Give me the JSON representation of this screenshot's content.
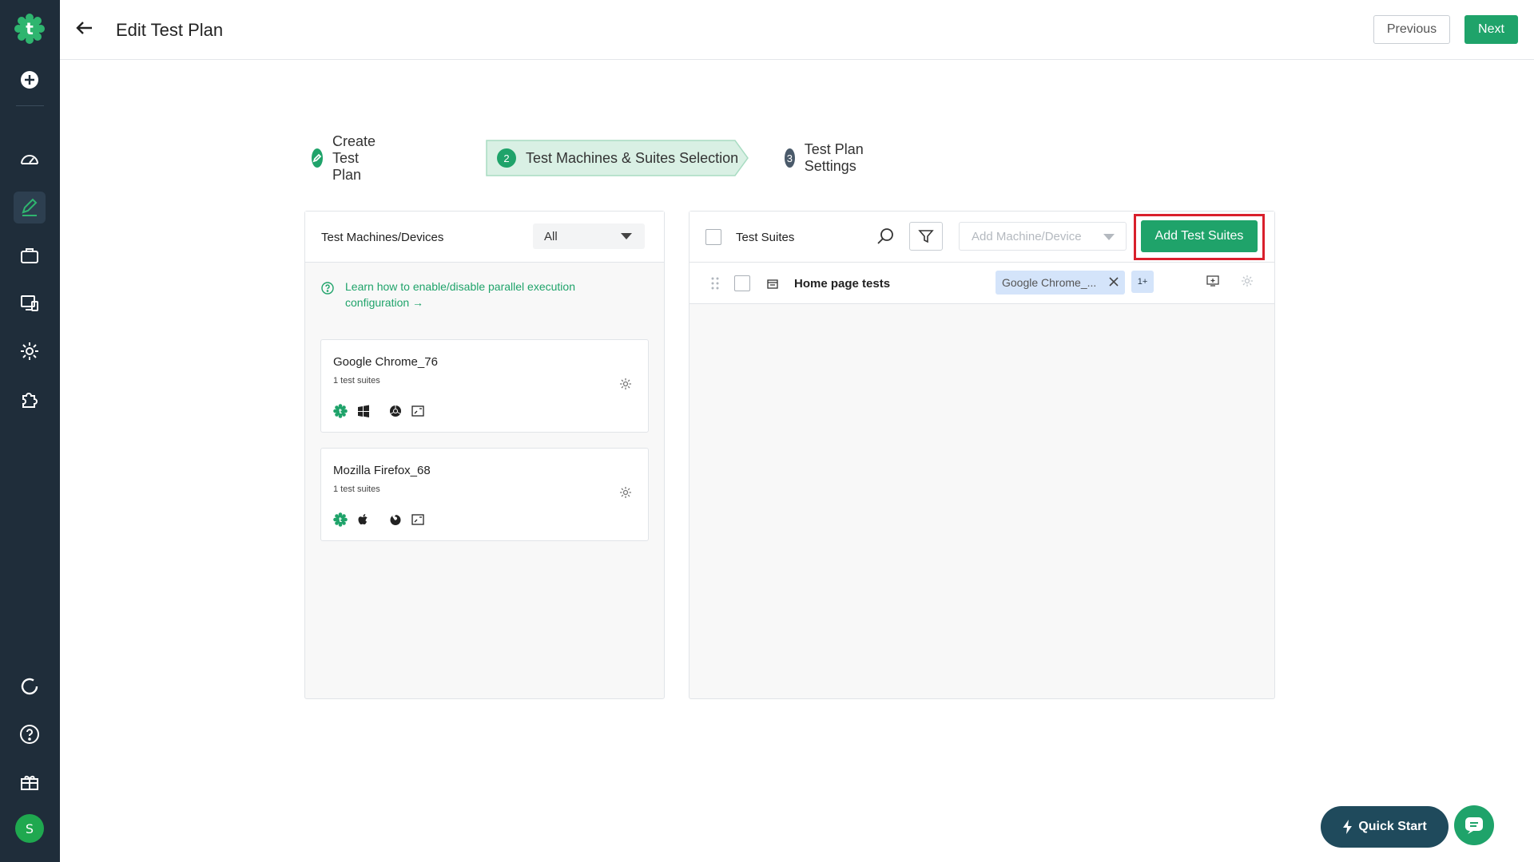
{
  "sidebar": {
    "logo_icon": "testsigma-logo-icon",
    "items": [
      {
        "name": "add-icon"
      },
      {
        "name": "dashboard-icon"
      },
      {
        "name": "test-plan-icon",
        "active": true
      },
      {
        "name": "briefcase-icon"
      },
      {
        "name": "test-devices-icon"
      },
      {
        "name": "settings-icon"
      },
      {
        "name": "addons-icon"
      }
    ],
    "bottom_items": [
      {
        "name": "refresh-icon"
      },
      {
        "name": "help-icon"
      },
      {
        "name": "gift-icon"
      }
    ],
    "avatar_initial": "S"
  },
  "header": {
    "title": "Edit Test Plan",
    "previous_label": "Previous",
    "next_label": "Next"
  },
  "stepper": {
    "steps": [
      {
        "number": "",
        "label": "Create Test Plan",
        "state": "done"
      },
      {
        "number": "2",
        "label": "Test Machines & Suites Selection",
        "state": "active"
      },
      {
        "number": "3",
        "label": "Test Plan Settings",
        "state": "pending"
      }
    ]
  },
  "machines_panel": {
    "title": "Test Machines/Devices",
    "filter_value": "All",
    "help_text": "Learn how to enable/disable parallel execution configuration →",
    "machines": [
      {
        "name": "Google Chrome_76",
        "suites": "1 test suites",
        "os_icon": "windows-icon",
        "browser_icon": "chrome-icon"
      },
      {
        "name": "Mozilla Firefox_68",
        "suites": "1 test suites",
        "os_icon": "apple-icon",
        "browser_icon": "firefox-icon"
      }
    ]
  },
  "suites_panel": {
    "title": "Test Suites",
    "add_machine_placeholder": "Add Machine/Device",
    "add_suites_label": "Add Test Suites",
    "rows": [
      {
        "name": "Home page tests",
        "machine_chip": "Google Chrome_...",
        "more": "1+"
      }
    ]
  },
  "footer": {
    "quick_start_label": "Quick Start"
  },
  "colors": {
    "brand_green": "#1fa36a",
    "sidebar_bg": "#1f2d3a",
    "highlight_red": "#d9202c",
    "chip_blue": "#d4e4fa"
  }
}
